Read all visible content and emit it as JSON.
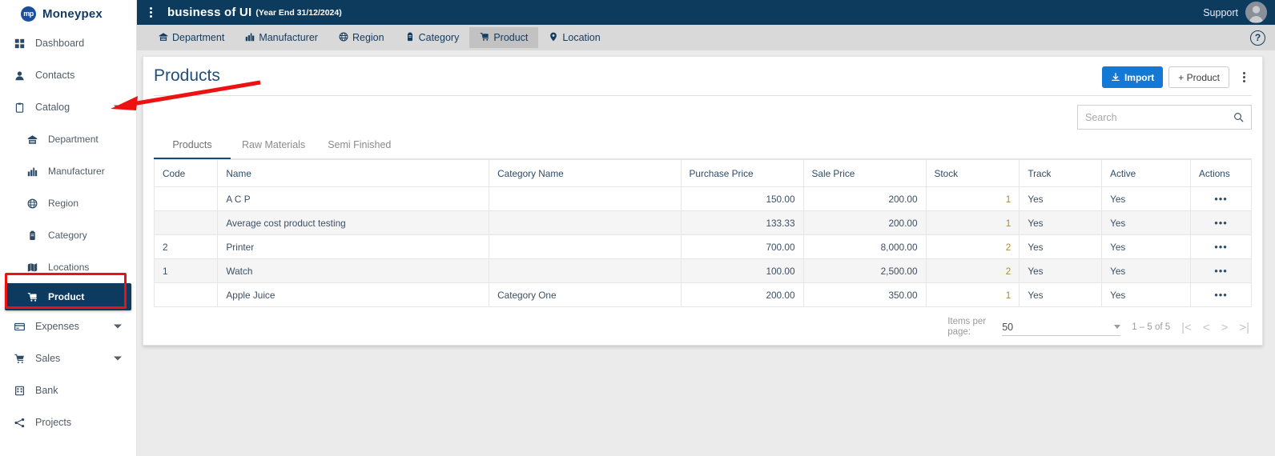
{
  "brand": {
    "name": "Moneypex",
    "mark": "mp",
    "color": "#1b4f9c"
  },
  "topbar": {
    "menu_icon": "kebab-vertical-icon",
    "business_title": "business of UI",
    "year_end": "(Year End 31/12/2024)",
    "support_label": "Support",
    "avatar": "user-avatar"
  },
  "sidebar": {
    "items": [
      {
        "label": "Dashboard",
        "icon": "dashboard-icon",
        "level": "top",
        "caret": false,
        "active": false
      },
      {
        "label": "Contacts",
        "icon": "contacts-icon",
        "level": "top",
        "caret": false,
        "active": false
      },
      {
        "label": "Catalog",
        "icon": "catalog-icon",
        "level": "top",
        "caret": true,
        "active": false
      },
      {
        "label": "Department",
        "icon": "department-icon",
        "level": "sub",
        "caret": false,
        "active": false
      },
      {
        "label": "Manufacturer",
        "icon": "manufacturer-icon",
        "level": "sub",
        "caret": false,
        "active": false
      },
      {
        "label": "Region",
        "icon": "region-icon",
        "level": "sub",
        "caret": false,
        "active": false
      },
      {
        "label": "Category",
        "icon": "category-icon",
        "level": "sub",
        "caret": false,
        "active": false
      },
      {
        "label": "Locations",
        "icon": "locations-icon",
        "level": "sub",
        "caret": false,
        "active": false
      },
      {
        "label": "Product",
        "icon": "product-icon",
        "level": "sub",
        "caret": false,
        "active": true
      },
      {
        "label": "Expenses",
        "icon": "expenses-icon",
        "level": "top",
        "caret": true,
        "active": false
      },
      {
        "label": "Sales",
        "icon": "sales-icon",
        "level": "top",
        "caret": true,
        "active": false
      },
      {
        "label": "Bank",
        "icon": "bank-icon",
        "level": "top",
        "caret": false,
        "active": false
      },
      {
        "label": "Projects",
        "icon": "projects-icon",
        "level": "top",
        "caret": false,
        "active": false
      }
    ]
  },
  "subnav": {
    "items": [
      {
        "label": "Department",
        "icon": "department-icon",
        "selected": false
      },
      {
        "label": "Manufacturer",
        "icon": "manufacturer-icon",
        "selected": false
      },
      {
        "label": "Region",
        "icon": "region-icon",
        "selected": false
      },
      {
        "label": "Category",
        "icon": "category-icon",
        "selected": false
      },
      {
        "label": "Product",
        "icon": "product-icon",
        "selected": true
      },
      {
        "label": "Location",
        "icon": "location-pin-icon",
        "selected": false
      }
    ],
    "help_label": "?"
  },
  "main": {
    "page_title": "Products",
    "import_button": "Import",
    "add_product_button": "+ Product",
    "overflow_icon": "kebab-vertical-icon",
    "search": {
      "value": "",
      "placeholder": "Search",
      "icon": "search-icon"
    },
    "tabs": [
      {
        "label": "Products",
        "active": true
      },
      {
        "label": "Raw Materials",
        "active": false
      },
      {
        "label": "Semi Finished",
        "active": false
      }
    ],
    "table": {
      "columns": [
        "Code",
        "Name",
        "Category Name",
        "Purchase Price",
        "Sale Price",
        "Stock",
        "Track",
        "Active",
        "Actions"
      ],
      "rows": [
        {
          "code": "",
          "name": "A C P",
          "category": "",
          "purchase": "150.00",
          "sale": "200.00",
          "stock": "1",
          "track": "Yes",
          "active": "Yes",
          "actions": "•••"
        },
        {
          "code": "",
          "name": "Average cost product testing",
          "category": "",
          "purchase": "133.33",
          "sale": "200.00",
          "stock": "1",
          "track": "Yes",
          "active": "Yes",
          "actions": "•••"
        },
        {
          "code": "2",
          "name": "Printer",
          "category": "",
          "purchase": "700.00",
          "sale": "8,000.00",
          "stock": "2",
          "track": "Yes",
          "active": "Yes",
          "actions": "•••"
        },
        {
          "code": "1",
          "name": "Watch",
          "category": "",
          "purchase": "100.00",
          "sale": "2,500.00",
          "stock": "2",
          "track": "Yes",
          "active": "Yes",
          "actions": "•••"
        },
        {
          "code": "",
          "name": "Apple Juice",
          "category": "Category One",
          "purchase": "200.00",
          "sale": "350.00",
          "stock": "1",
          "track": "Yes",
          "active": "Yes",
          "actions": "•••"
        }
      ]
    },
    "paginator": {
      "items_per_page_label": "Items per page:",
      "items_per_page_value": "50",
      "range_label": "1 – 5 of 5",
      "first_icon": "|<",
      "prev_icon": "<",
      "next_icon": ">",
      "last_icon": ">|"
    }
  },
  "annotations": {
    "arrow_color": "#ee1111",
    "highlight_box_color": "#ee1111",
    "highlight_target": "sidebar-item-product"
  }
}
